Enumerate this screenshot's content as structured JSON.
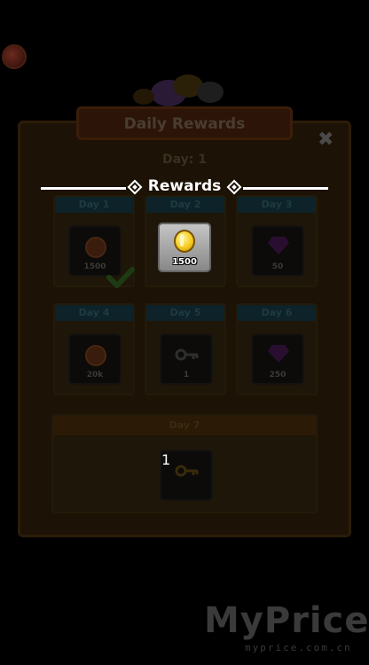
{
  "screen": {
    "title": "Daily Rewards",
    "current_day": "Day: 1",
    "section_title": "Rewards",
    "close_icon": "close-icon"
  },
  "days": [
    {
      "label": "Day 1",
      "icon": "ball-icon",
      "amount": "1500",
      "claimed": true
    },
    {
      "label": "Day 2",
      "icon": "coin-icon",
      "amount": "1500",
      "highlighted": true
    },
    {
      "label": "Day 3",
      "icon": "gem-icon",
      "amount": "50"
    },
    {
      "label": "Day 4",
      "icon": "ball-icon",
      "amount": "20k"
    },
    {
      "label": "Day 5",
      "icon": "key-icon",
      "amount": "1"
    },
    {
      "label": "Day 6",
      "icon": "gem-icon",
      "amount": "250"
    },
    {
      "label": "Day 7",
      "icon": "key-icon",
      "amount": "1"
    }
  ],
  "watermark": {
    "main": "MyPrice",
    "sub": "myprice.com.cn"
  },
  "colors": {
    "panel_bg": "#1c1205",
    "highlight_coin": "#f7cc1f",
    "card_header": "#0d2229"
  }
}
